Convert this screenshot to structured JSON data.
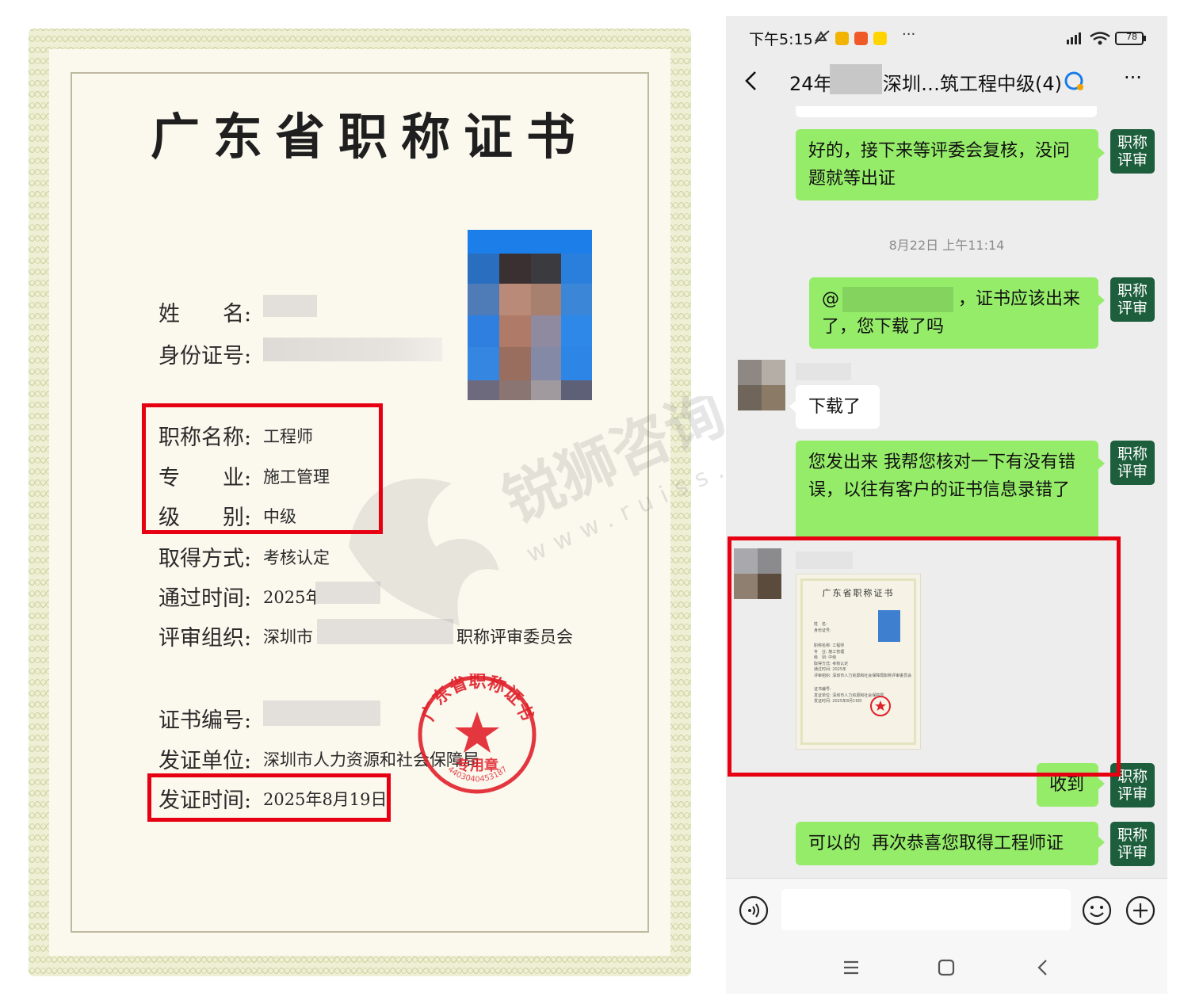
{
  "certificate": {
    "title": "广东省职称证书",
    "labels": {
      "name": "姓　　名:",
      "id_number": "身份证号:",
      "title_name": "职称名称:",
      "specialty": "专　　业:",
      "level": "级　　别:",
      "method": "取得方式:",
      "pass_time": "通过时间:",
      "review_org": "评审组织:",
      "cert_number": "证书编号:",
      "issuer": "发证单位:",
      "issue_date": "发证时间:"
    },
    "values": {
      "title_name": "工程师",
      "specialty": "施工管理",
      "level": "中级",
      "method": "考核认定",
      "pass_time_prefix": "2025年",
      "review_org_prefix": "深圳市",
      "review_org_suffix": "职称评审委员会",
      "issuer": "深圳市人力资源和社会保障局",
      "issue_date": "2025年8月19日"
    },
    "seal_text": "广东省职称证书专用章",
    "seal_number": "4403040453187",
    "watermark": {
      "brand": "锐狮咨询",
      "url": "www.ruiss.vip"
    },
    "colors": {
      "highlight": "#e60012",
      "seal": "#e0202a"
    }
  },
  "phone": {
    "status_bar": {
      "time": "下午5:15",
      "battery": "78",
      "more": "···"
    },
    "header": {
      "back_icon": "chevron-left-icon",
      "title_left": "24年",
      "title_right": "深圳…筑工程中级(4)",
      "more": "···"
    },
    "messages": [
      {
        "side": "self",
        "text": "好的，接下来等评委会复核，没问题就等出证"
      },
      {
        "type": "timestamp",
        "text": "8月22日 上午11:14"
      },
      {
        "side": "self",
        "text_prefix": "@",
        "text": "，证书应该出来了，您下载了吗"
      },
      {
        "side": "other",
        "text": "下载了"
      },
      {
        "side": "self",
        "text": "您发出来 我帮您核对一下有没有错误，以往有客户的证书信息录错了"
      },
      {
        "side": "other",
        "type": "image",
        "caption": "广东省职称证书"
      },
      {
        "side": "self",
        "text": "收到"
      },
      {
        "side": "self",
        "text": "可以的  再次恭喜您取得工程师证"
      }
    ],
    "self_avatar": {
      "line1": "职称",
      "line2": "评审"
    },
    "thumbnail": {
      "labels": [
        "姓　名:",
        "身份证号:",
        "职称名称: 工程师",
        "专　业: 施工管理",
        "级　别: 中级",
        "取得方式: 考核认定",
        "通过时间: 2025年",
        "评审组织: 深圳市人力资源和社会保障局职称评审委员会",
        "证书编号:",
        "发证单位: 深圳市人力资源和社会保障局",
        "发证时间: 2025年8月19日"
      ]
    },
    "colors": {
      "bubble_self": "#95ec69",
      "bubble_other": "#ffffff",
      "avatar": "#1d5e3c",
      "background": "#ededed"
    }
  }
}
